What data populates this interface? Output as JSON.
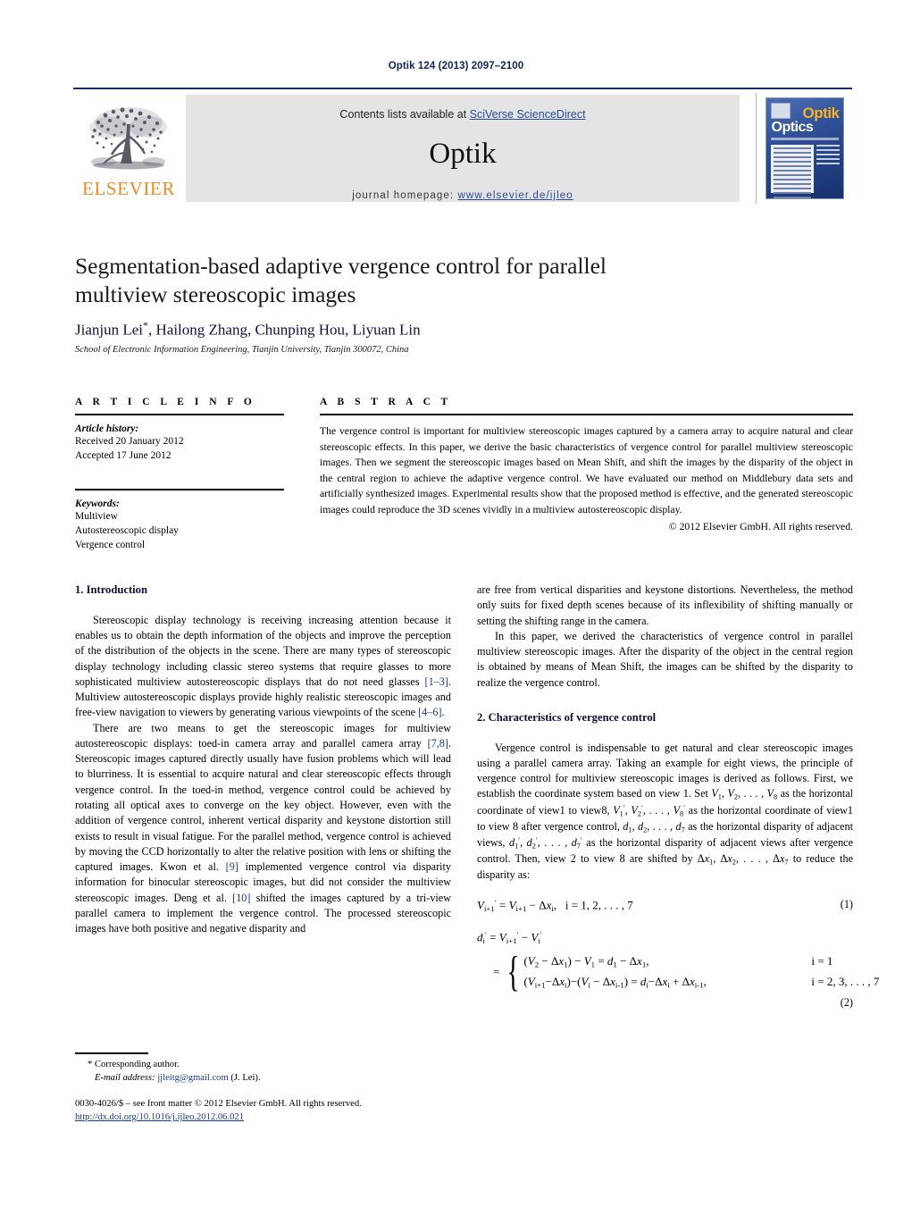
{
  "running_head": "Optik 124 (2013) 2097–2100",
  "masthead": {
    "publisher_name": "ELSEVIER",
    "contents_prefix": "Contents lists available at ",
    "contents_link": "SciVerse ScienceDirect",
    "journal_title": "Optik",
    "homepage_label": "journal homepage: ",
    "homepage_url": "www.elsevier.de/ijleo",
    "cover_title_top": "Optik",
    "cover_title_bottom": "Optics"
  },
  "article": {
    "title": "Segmentation-based adaptive vergence control for parallel multiview stereoscopic images",
    "authors": "Jianjun Lei",
    "authors_rest": ", Hailong Zhang, Chunping Hou, Liyuan Lin",
    "corresponding_marker": "*",
    "affiliation": "School of Electronic Information Engineering, Tianjin University, Tianjin 300072, China"
  },
  "info": {
    "heading": "A R T I C L E   I N F O",
    "history_label": "Article history:",
    "received": "Received 20 January 2012",
    "accepted": "Accepted 17 June 2012",
    "keywords_label": "Keywords:",
    "keywords": [
      "Multiview",
      "Autostereoscopic display",
      "Vergence control"
    ]
  },
  "abstract": {
    "heading": "A B S T R A C T",
    "text": "The vergence control is important for multiview stereoscopic images captured by a camera array to acquire natural and clear stereoscopic effects. In this paper, we derive the basic characteristics of vergence control for parallel multiview stereoscopic images. Then we segment the stereoscopic images based on Mean Shift, and shift the images by the disparity of the object in the central region to achieve the adaptive vergence control. We have evaluated our method on Middlebury data sets and artificially synthesized images. Experimental results show that the proposed method is effective, and the generated stereoscopic images could reproduce the 3D scenes vividly in a multiview autostereoscopic display.",
    "copyright": "© 2012 Elsevier GmbH. All rights reserved."
  },
  "body": {
    "section1_heading": "1.  Introduction",
    "s1_p1_a": "Stereoscopic display technology is receiving increasing attention because it enables us to obtain the depth information of the objects and improve the perception of the distribution of the objects in the scene. There are many types of stereoscopic display technology including classic stereo systems that require glasses to more sophisticated multiview autostereoscopic displays that do not need glasses ",
    "s1_p1_ref1": "[1–3]",
    "s1_p1_b": ". Multiview autostereoscopic displays provide highly realistic stereoscopic images and free-view navigation to viewers by generating various viewpoints of the scene ",
    "s1_p1_ref2": "[4–6]",
    "s1_p1_c": ".",
    "s1_p2_a": "There are two means to get the stereoscopic images for multiview autostereoscopic displays: toed-in camera array and parallel camera array ",
    "s1_p2_ref1": "[7,8]",
    "s1_p2_b": ". Stereoscopic images captured directly usually have fusion problems which will lead to blurriness. It is essential to acquire natural and clear stereoscopic effects through vergence control. In the toed-in method, vergence control could be achieved by rotating all optical axes to converge on the key object. However, even with the addition of vergence control, inherent vertical disparity and keystone distortion still exists to result in visual fatigue. For the parallel method, vergence control is achieved by moving the CCD horizontally to alter the relative position with lens or shifting the captured images. Kwon et al. ",
    "s1_p2_ref2": "[9]",
    "s1_p2_c": " implemented vergence control via disparity information for binocular stereoscopic images, but did not consider the multiview stereoscopic images. Deng et al. ",
    "s1_p2_ref3": "[10]",
    "s1_p2_d": " shifted the images captured by a tri-view parallel camera to implement the vergence control. The processed stereoscopic images have both positive and negative disparity and",
    "s1_p3": "are free from vertical disparities and keystone distortions. Nevertheless, the method only suits for fixed depth scenes because of its inflexibility of shifting manually or setting the shifting range in the camera.",
    "s1_p4": "In this paper, we derived the characteristics of vergence control in parallel multiview stereoscopic images. After the disparity of the object in the central region is obtained by means of Mean Shift, the images can be shifted by the disparity to realize the vergence control.",
    "section2_heading": "2.  Characteristics of vergence control",
    "s2_p1_part1": "Vergence control is indispensable to get natural and clear stereoscopic images using a parallel camera array. Taking an example for eight views, the principle of vergence control for multiview stereoscopic images is derived as follows. First, we establish the coordinate system based on view 1. Set ",
    "s2_p1_part2": " as the horizontal coordinate of view1 to view8, ",
    "s2_p1_part3": " as the horizontal coordinate of view1 to view 8 after vergence control, ",
    "s2_p1_part4": " as the horizontal disparity of adjacent views, ",
    "s2_p1_part5": " as the horizontal disparity of adjacent views after vergence control. Then, view 2 to view 8 are shifted by ",
    "s2_p1_part6": " to reduce the disparity as:"
  },
  "equations": {
    "eq1_number": "(1)",
    "eq1_condition": "i = 1, 2, . . . , 7",
    "eq2_number": "(2)",
    "eq2_case1_cond": "i = 1",
    "eq2_case2_cond": "i = 2, 3, . . . , 7"
  },
  "footer": {
    "corresponding": "* Corresponding author.",
    "email_label": "E-mail address: ",
    "email": "jjleitg@gmail.com",
    "email_owner": " (J. Lei).",
    "issn_line": "0030-4026/$ – see front matter © 2012 Elsevier GmbH. All rights reserved.",
    "doi": "http://dx.doi.org/10.1016/j.ijleo.2012.06.021"
  },
  "colors": {
    "header_blue": "#13235b",
    "link_blue": "#2b4a9b",
    "ref_blue": "#1a3a8f",
    "elsevier_orange": "#eb8b2b",
    "banner_gray": "#e4e4e4"
  }
}
